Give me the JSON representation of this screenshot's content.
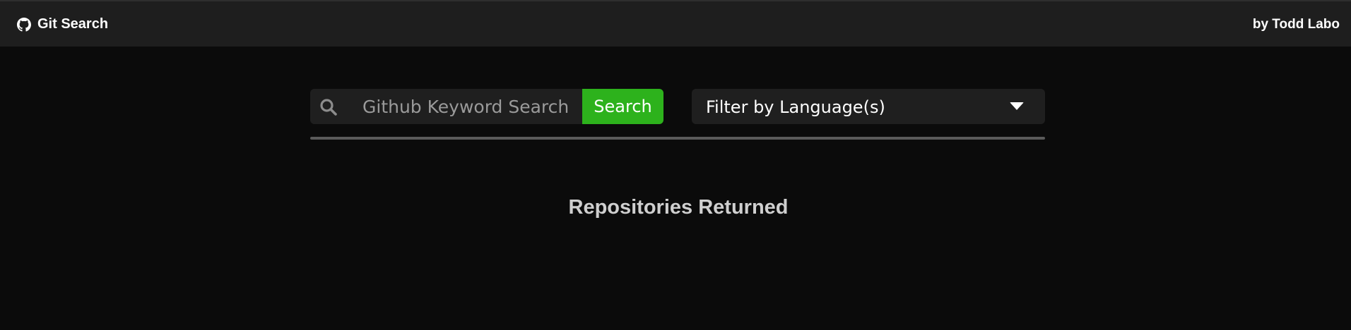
{
  "navbar": {
    "brand_label": "Git Search",
    "brand_icon": "github-icon",
    "author_label": "by Todd Labo"
  },
  "search": {
    "placeholder": "Github Keyword Search",
    "value": "",
    "button_label": "Search",
    "icon": "search-icon",
    "accent_color": "#2db21c"
  },
  "filter": {
    "label": "Filter by Language(s)",
    "icon": "caret-down-icon"
  },
  "results": {
    "title": "Repositories Returned"
  }
}
